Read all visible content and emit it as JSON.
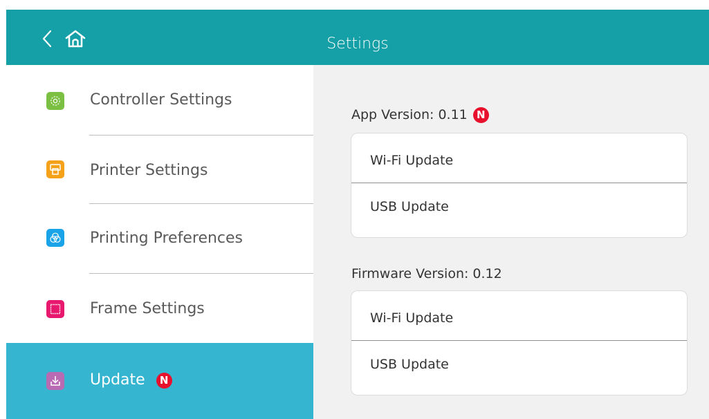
{
  "header": {
    "title": "Settings",
    "background": "#14a0a6",
    "back_icon": "chevron-left-icon",
    "home_icon": "home-icon"
  },
  "sidebar": {
    "items": [
      {
        "label": "Controller Settings",
        "icon": "gear-icon",
        "icon_color": "#7bc043",
        "active": false
      },
      {
        "label": "Printer Settings",
        "icon": "printer-icon",
        "icon_color": "#f5a11a",
        "active": false
      },
      {
        "label": "Printing Preferences",
        "icon": "color-circles-icon",
        "icon_color": "#1aa3e8",
        "active": false
      },
      {
        "label": "Frame Settings",
        "icon": "frame-icon",
        "icon_color": "#e8186e",
        "active": false
      },
      {
        "label": "Update",
        "icon": "download-icon",
        "icon_color": "#b86bb3",
        "active": true,
        "badge": "N"
      }
    ],
    "active_color": "#35b5d0"
  },
  "content": {
    "app": {
      "title": "App Version: 0.11",
      "badge": "N",
      "rows": [
        "Wi-Fi Update",
        "USB Update"
      ]
    },
    "firmware": {
      "title": "Firmware Version: 0.12",
      "rows": [
        "Wi-Fi Update",
        "USB Update"
      ]
    }
  },
  "colors": {
    "badge": "#e8112d",
    "content_bg": "#f1f1f1"
  }
}
